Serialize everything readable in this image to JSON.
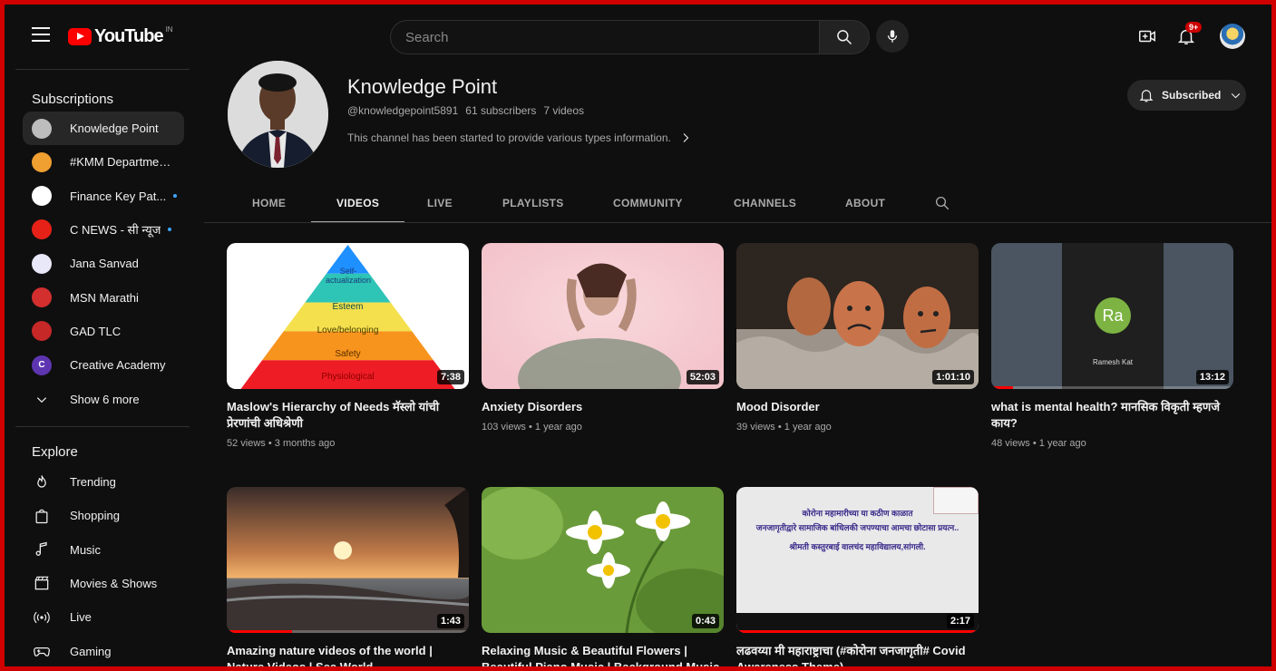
{
  "header": {
    "logo_text": "YouTube",
    "country": "IN",
    "search_placeholder": "Search",
    "notifications_badge": "9+"
  },
  "sidebar": {
    "subscriptions_heading": "Subscriptions",
    "subscriptions": [
      {
        "label": "Knowledge Point",
        "color": "#bdbdbd",
        "active": true,
        "dot": false
      },
      {
        "label": "#KMM Department ...",
        "color": "#f0a030",
        "active": false,
        "dot": false
      },
      {
        "label": "Finance Key Pat...",
        "color": "#ffffff",
        "active": false,
        "dot": true
      },
      {
        "label": "C NEWS - सी न्यूज",
        "color": "#e62117",
        "active": false,
        "dot": true
      },
      {
        "label": "Jana Sanvad",
        "color": "#e8e8f8",
        "active": false,
        "dot": false
      },
      {
        "label": "MSN Marathi",
        "color": "#d32f2f",
        "active": false,
        "dot": false
      },
      {
        "label": "GAD TLC",
        "color": "#c62828",
        "active": false,
        "dot": false
      },
      {
        "label": "Creative Academy",
        "color": "#5e35b1",
        "active": false,
        "dot": false,
        "letter": "C"
      }
    ],
    "show_more": "Show 6 more",
    "explore_heading": "Explore",
    "explore": [
      {
        "label": "Trending",
        "icon": "trending-icon"
      },
      {
        "label": "Shopping",
        "icon": "shopping-icon"
      },
      {
        "label": "Music",
        "icon": "music-icon"
      },
      {
        "label": "Movies & Shows",
        "icon": "movies-icon"
      },
      {
        "label": "Live",
        "icon": "live-icon"
      },
      {
        "label": "Gaming",
        "icon": "gaming-icon"
      }
    ]
  },
  "channel": {
    "name": "Knowledge Point",
    "handle": "@knowledgepoint5891",
    "subscribers": "61 subscribers",
    "videos": "7 videos",
    "description": "This channel has been started to provide various types information.",
    "subscribe_label": "Subscribed"
  },
  "tabs": [
    "HOME",
    "VIDEOS",
    "LIVE",
    "PLAYLISTS",
    "COMMUNITY",
    "CHANNELS",
    "ABOUT"
  ],
  "videos": [
    {
      "title": "Maslow's Hierarchy of Needs मॅस्लो यांची प्रेरणांची अधिश्रेणी",
      "views": "52 views",
      "age": "3 months ago",
      "duration": "7:38",
      "progress": 0,
      "pyramid": [
        "Self-actualization",
        "Esteem",
        "Love/belonging",
        "Safety",
        "Physiological"
      ]
    },
    {
      "title": "Anxiety Disorders",
      "views": "103 views",
      "age": "1 year ago",
      "duration": "52:03",
      "progress": 0
    },
    {
      "title": "Mood Disorder",
      "views": "39 views",
      "age": "1 year ago",
      "duration": "1:01:10",
      "progress": 0
    },
    {
      "title": "what is mental health? मानसिक विकृती म्हणजे काय?",
      "views": "48 views",
      "age": "1 year ago",
      "duration": "13:12",
      "progress": 0.09,
      "avatar_initials": "Ra",
      "avatar_name": "Ramesh Kat"
    },
    {
      "title": "Amazing nature videos of the world | Nature Videos | Sea World",
      "views": "",
      "age": "",
      "duration": "1:43",
      "progress": 0.27
    },
    {
      "title": "Relaxing Music & Beautiful Flowers | Beautiful Piano Music | Background Music ...",
      "views": "",
      "age": "",
      "duration": "0:43",
      "progress": 0
    },
    {
      "title": "लढवय्या मी महाराष्ट्राचा (#कोरोना जनजागृती# Covid Awareness Theme)",
      "views": "",
      "age": "",
      "duration": "2:17",
      "progress": 1.0,
      "slide_lines": [
        "कोरोना महामारीच्या या कठीण काळात",
        "जनजागृतीद्वारे सामाजिक बांधिलकी जपण्याचा आमचा छोटासा प्रयत्न..",
        "श्रीमती कस्तुरबाई वालचंद महाविद्यालय,सांगली."
      ]
    }
  ]
}
